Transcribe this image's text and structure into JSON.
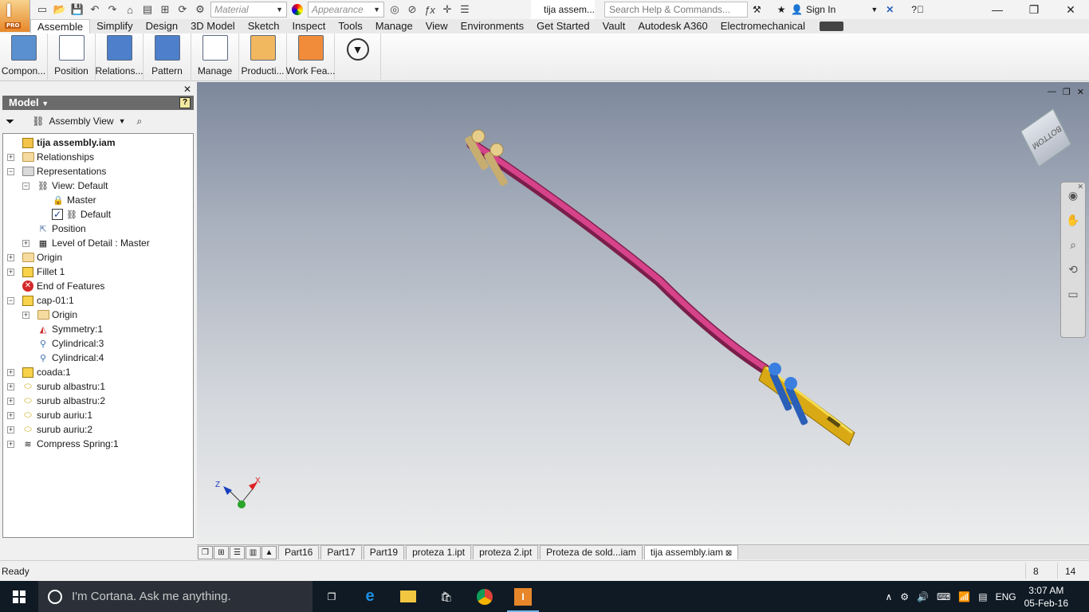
{
  "app": {
    "logo_letter": "I",
    "logo_badge": "PRO",
    "document_title": "tija assem...",
    "material_placeholder": "Material",
    "appearance_placeholder": "Appearance",
    "search_placeholder": "Search Help & Commands...",
    "sign_in": "Sign In"
  },
  "ribbon_tabs": [
    "Assemble",
    "Simplify",
    "Design",
    "3D Model",
    "Sketch",
    "Inspect",
    "Tools",
    "Manage",
    "View",
    "Environments",
    "Get Started",
    "Vault",
    "Autodesk A360",
    "Electromechanical"
  ],
  "ribbon_buttons": [
    "Compon...",
    "Position",
    "Relations...",
    "Pattern",
    "Manage",
    "Producti...",
    "Work Fea..."
  ],
  "browser": {
    "header": "Model",
    "view_mode": "Assembly View",
    "tree": [
      {
        "label": "tija assembly.iam",
        "level": 0,
        "expand": "",
        "icon": "assembly-icon",
        "bold": true
      },
      {
        "label": "Relationships",
        "level": 0,
        "expand": "+",
        "icon": "folder-icon"
      },
      {
        "label": "Representations",
        "level": 0,
        "expand": "-",
        "icon": "representations-icon"
      },
      {
        "label": "View: Default",
        "level": 1,
        "expand": "-",
        "icon": "view-rep-icon"
      },
      {
        "label": "Master",
        "level": 2,
        "expand": "",
        "icon": "lock-icon"
      },
      {
        "label": "Default",
        "level": 2,
        "expand": "",
        "icon": "view-rep-icon",
        "checked": true
      },
      {
        "label": "Position",
        "level": 1,
        "expand": "",
        "icon": "position-icon"
      },
      {
        "label": "Level of Detail : Master",
        "level": 1,
        "expand": "+",
        "icon": "lod-icon"
      },
      {
        "label": "Origin",
        "level": 0,
        "expand": "+",
        "icon": "folder-icon"
      },
      {
        "label": "Fillet 1",
        "level": 0,
        "expand": "+",
        "icon": "fillet-icon"
      },
      {
        "label": "End of Features",
        "level": 0,
        "expand": "",
        "icon": "end-of-features-icon"
      },
      {
        "label": "cap-01:1",
        "level": 0,
        "expand": "-",
        "icon": "part-icon"
      },
      {
        "label": "Origin",
        "level": 1,
        "expand": "+",
        "icon": "folder-icon"
      },
      {
        "label": "Symmetry:1",
        "level": 1,
        "expand": "",
        "icon": "symmetry-icon"
      },
      {
        "label": "Cylindrical:3",
        "level": 1,
        "expand": "",
        "icon": "cylindrical-joint-icon"
      },
      {
        "label": "Cylindrical:4",
        "level": 1,
        "expand": "",
        "icon": "cylindrical-joint-icon"
      },
      {
        "label": "coada:1",
        "level": 0,
        "expand": "+",
        "icon": "part-icon"
      },
      {
        "label": "surub albastru:1",
        "level": 0,
        "expand": "+",
        "icon": "bolt-icon"
      },
      {
        "label": "surub albastru:2",
        "level": 0,
        "expand": "+",
        "icon": "bolt-icon"
      },
      {
        "label": "surub auriu:1",
        "level": 0,
        "expand": "+",
        "icon": "bolt-icon"
      },
      {
        "label": "surub auriu:2",
        "level": 0,
        "expand": "+",
        "icon": "bolt-icon"
      },
      {
        "label": "Compress Spring:1",
        "level": 0,
        "expand": "+",
        "icon": "spring-icon"
      }
    ]
  },
  "viewport": {
    "viewcube_label": "BOTTOM",
    "colors": {
      "rod": "#b8306e",
      "gold": "#e5c02b",
      "blue": "#2e6fd6",
      "screw_tan": "#d8c08a"
    }
  },
  "document_tabs": [
    "Part16",
    "Part17",
    "Part19",
    "proteza 1.ipt",
    "proteza 2.ipt",
    "Proteza de sold...iam",
    "tija assembly.iam"
  ],
  "active_document_tab": "tija assembly.iam",
  "status": {
    "text": "Ready",
    "count1": "8",
    "count2": "14"
  },
  "taskbar": {
    "cortana_placeholder": "I'm Cortana. Ask me anything.",
    "language": "ENG",
    "time": "3:07 AM",
    "date": "05-Feb-16"
  }
}
